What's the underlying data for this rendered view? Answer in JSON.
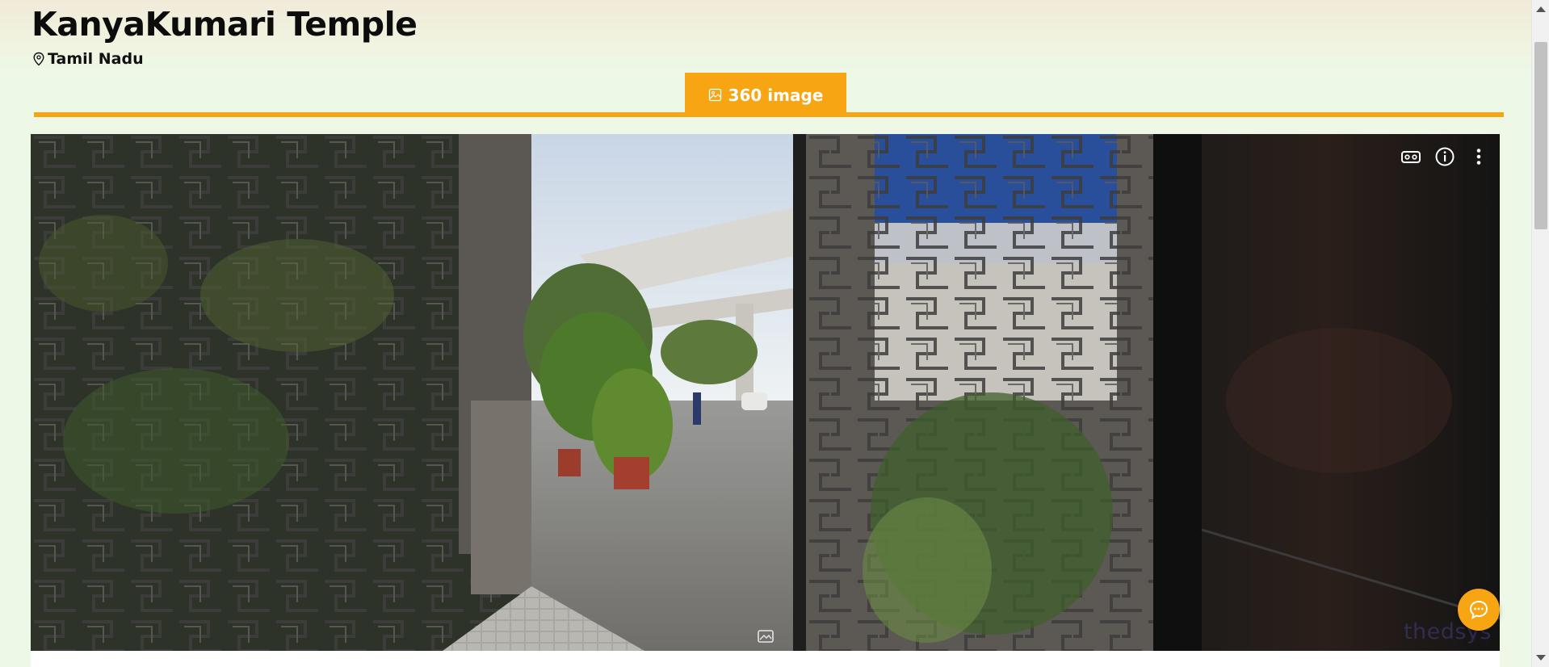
{
  "header": {
    "title": "KanyaKumari Temple",
    "location": "Tamil Nadu",
    "location_icon": "map-pin-icon"
  },
  "tabs": [
    {
      "label": "360 image",
      "icon": "image-icon",
      "active": true
    }
  ],
  "viewer": {
    "controls": [
      "vr-headset-icon",
      "info-icon",
      "more-vertical-icon"
    ],
    "watermark": "thedsys",
    "center_icon": "panorama-icon"
  },
  "chat": {
    "icon": "chat-bubble-icon"
  },
  "colors": {
    "accent": "#f7a513",
    "background": "#eef8e6"
  }
}
